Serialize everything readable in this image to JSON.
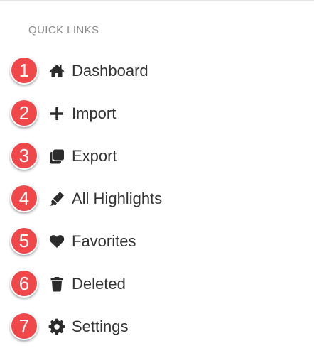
{
  "quick_links": {
    "heading": "QUICK LINKS",
    "items": [
      {
        "number": "1",
        "icon": "home-icon",
        "label": "Dashboard"
      },
      {
        "number": "2",
        "icon": "plus-icon",
        "label": "Import"
      },
      {
        "number": "3",
        "icon": "copy-icon",
        "label": "Export"
      },
      {
        "number": "4",
        "icon": "highlighter-icon",
        "label": "All Highlights"
      },
      {
        "number": "5",
        "icon": "heart-icon",
        "label": "Favorites"
      },
      {
        "number": "6",
        "icon": "trash-icon",
        "label": "Deleted"
      },
      {
        "number": "7",
        "icon": "gear-icon",
        "label": "Settings"
      }
    ]
  },
  "colors": {
    "badge": "#f0474a",
    "icon": "#2b2b2b",
    "label": "#333333",
    "heading": "#8a8a8a"
  }
}
